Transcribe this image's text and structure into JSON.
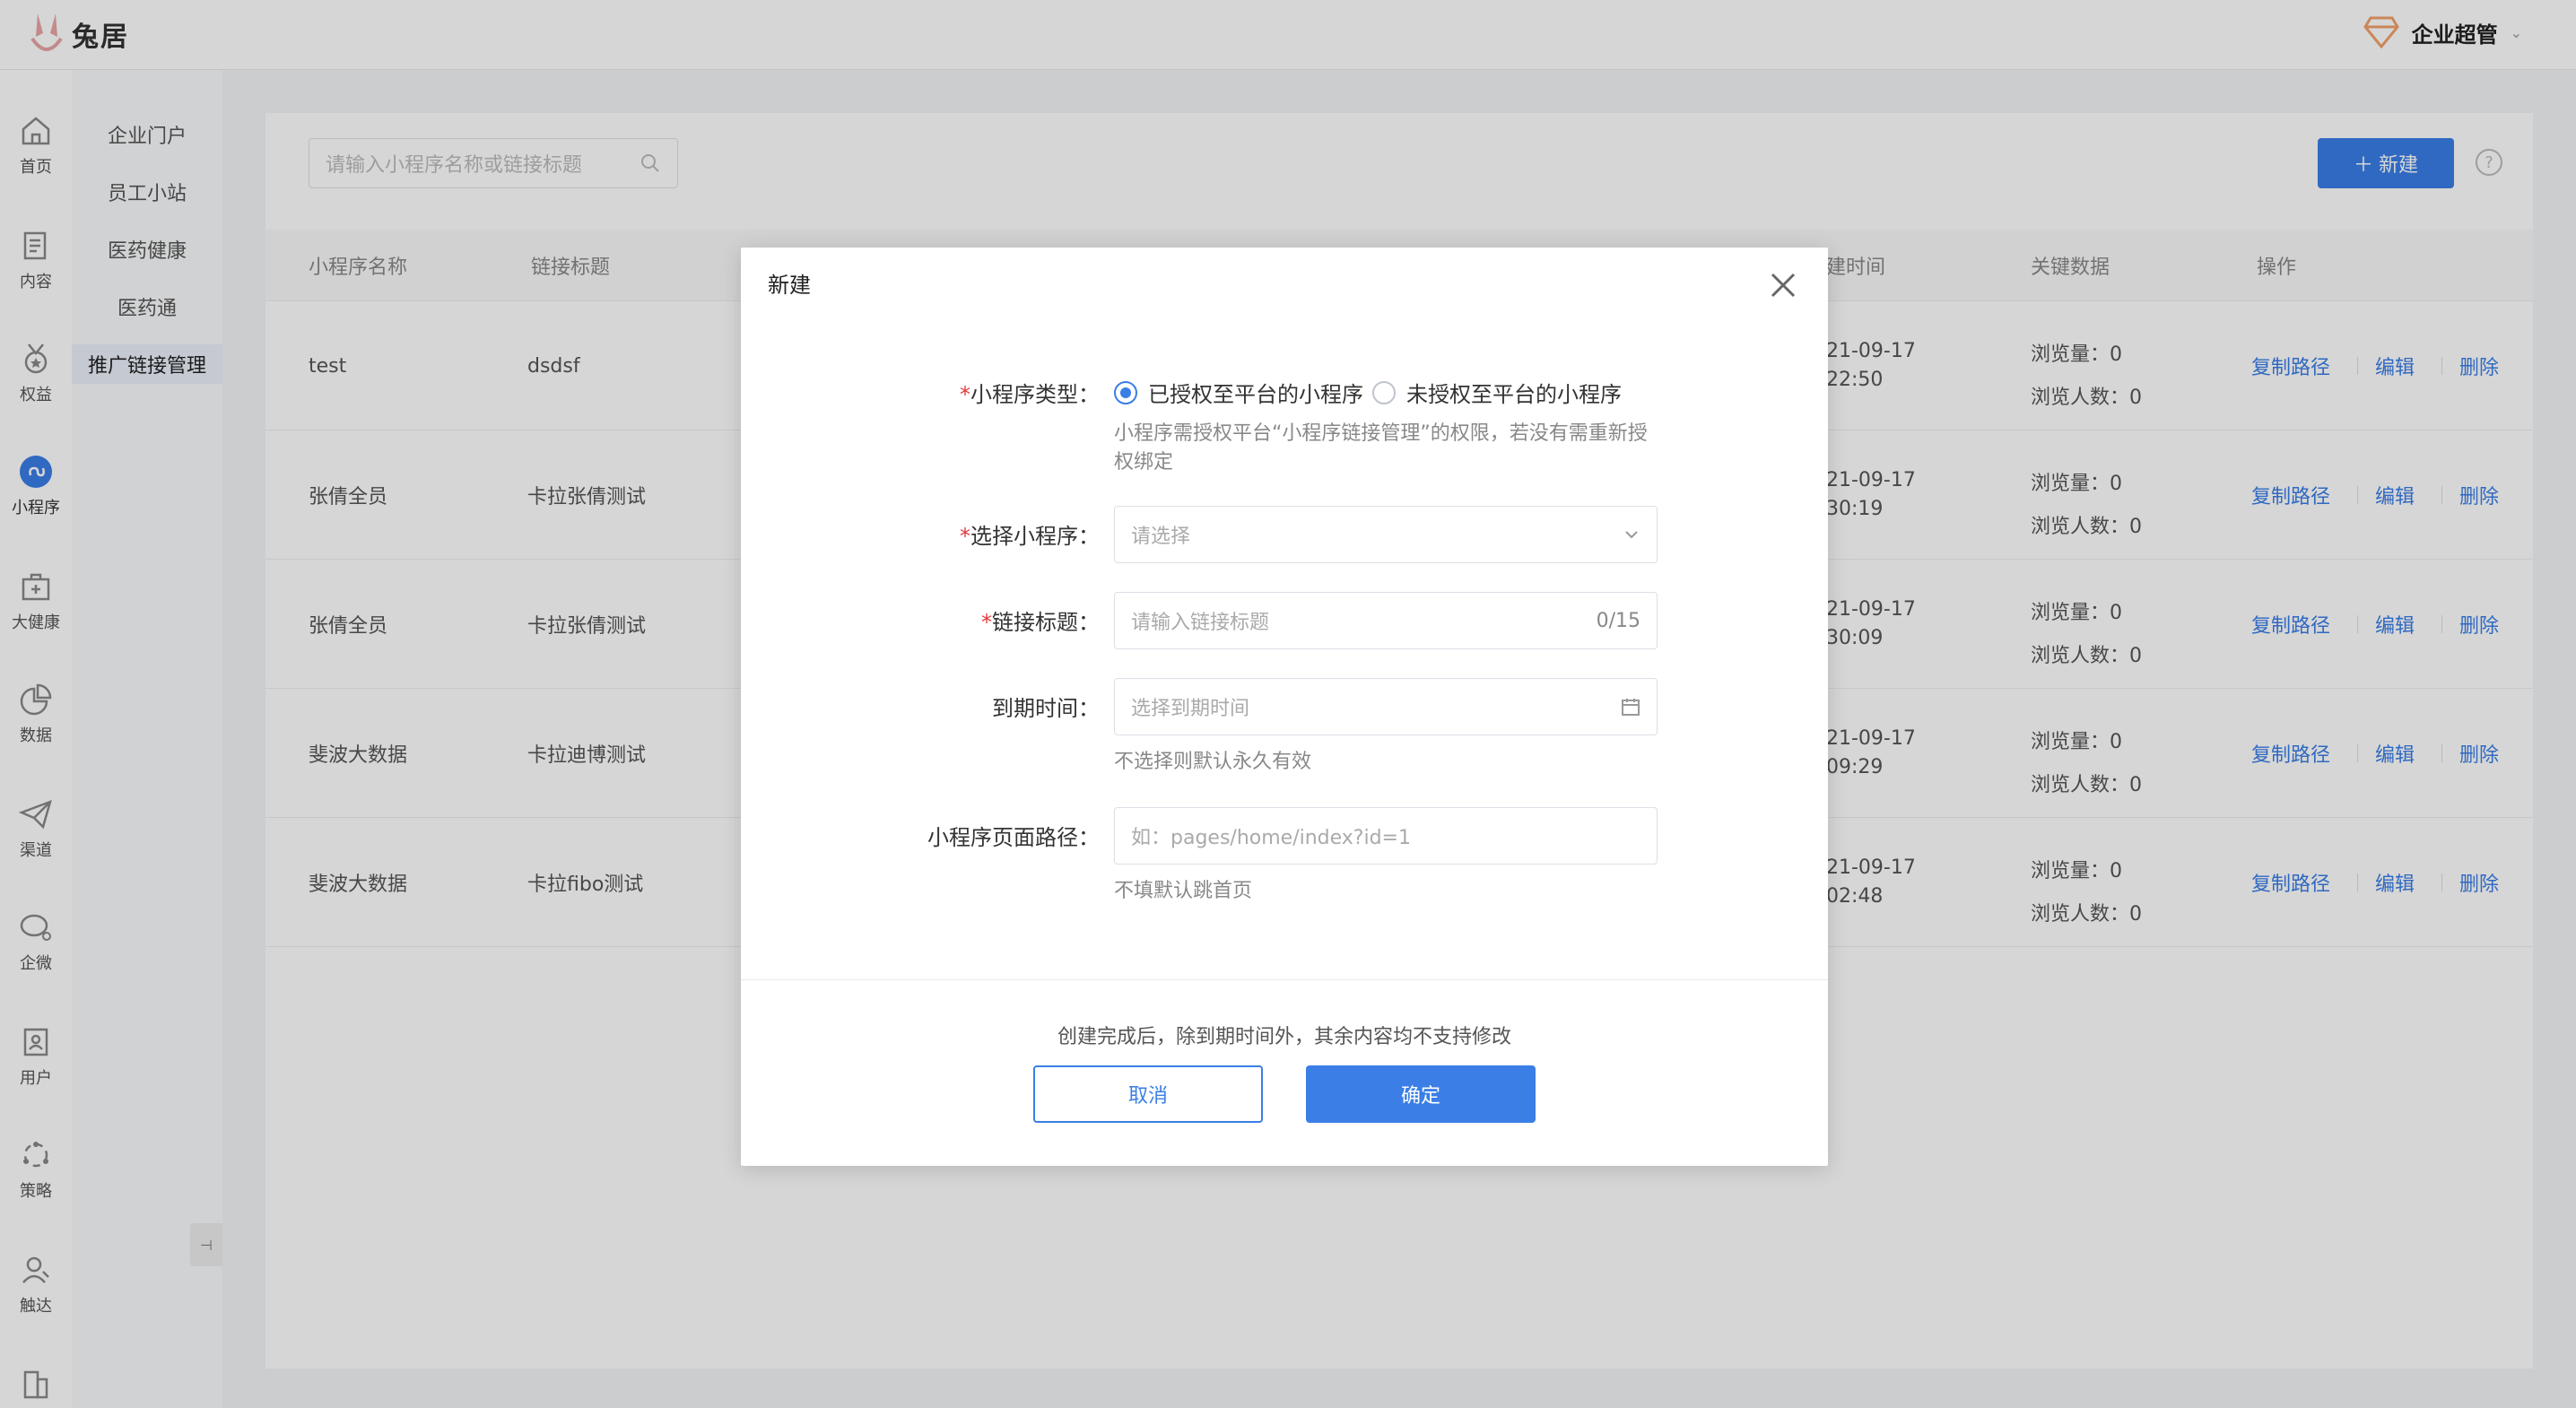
{
  "app": {
    "logo_text": "兔居",
    "user_name": "企业超管"
  },
  "rail": [
    {
      "label": "首页",
      "icon": "home-icon"
    },
    {
      "label": "内容",
      "icon": "document-icon"
    },
    {
      "label": "权益",
      "icon": "medal-icon"
    },
    {
      "label": "小程序",
      "icon": "miniprogram-icon"
    },
    {
      "label": "大健康",
      "icon": "health-kit-icon"
    },
    {
      "label": "数据",
      "icon": "pie-chart-icon"
    },
    {
      "label": "渠道",
      "icon": "paper-plane-icon"
    },
    {
      "label": "企微",
      "icon": "chat-icon"
    },
    {
      "label": "用户",
      "icon": "user-card-icon"
    },
    {
      "label": "策略",
      "icon": "strategy-icon"
    },
    {
      "label": "触达",
      "icon": "user-reach-icon"
    }
  ],
  "submenu": [
    "企业门户",
    "员工小站",
    "医药健康",
    "医药通",
    "推广链接管理"
  ],
  "toolbar": {
    "search_placeholder": "请输入小程序名称或链接标题",
    "new_label": "新建"
  },
  "table": {
    "headers": [
      "小程序名称",
      "链接标题",
      "建时间",
      "关键数据",
      "操作"
    ],
    "rows": [
      {
        "name": "test",
        "title": "dsdsf",
        "time1": "21-09-17",
        "time2": "22:50",
        "views": "浏览量：0",
        "visitors": "浏览人数：0"
      },
      {
        "name": "张倩全员",
        "title": "卡拉张倩测试",
        "time1": "21-09-17",
        "time2": "30:19",
        "views": "浏览量：0",
        "visitors": "浏览人数：0"
      },
      {
        "name": "张倩全员",
        "title": "卡拉张倩测试",
        "time1": "21-09-17",
        "time2": "30:09",
        "views": "浏览量：0",
        "visitors": "浏览人数：0"
      },
      {
        "name": "斐波大数据",
        "title": "卡拉迪博测试",
        "time1": "21-09-17",
        "time2": "09:29",
        "views": "浏览量：0",
        "visitors": "浏览人数：0"
      },
      {
        "name": "斐波大数据",
        "title": "卡拉fibo测试",
        "time1": "21-09-17",
        "time2": "02:48",
        "views": "浏览量：0",
        "visitors": "浏览人数：0"
      }
    ],
    "ops": {
      "copy": "复制路径",
      "edit": "编辑",
      "delete": "删除"
    }
  },
  "modal": {
    "title": "新建",
    "type_label": "小程序类型：",
    "type_options": [
      "已授权至平台的小程序",
      "未授权至平台的小程序"
    ],
    "type_hint_1": "小程序需授权平台“小程序链接管理”的权限，若没有需重新授",
    "type_hint_2": "权绑定",
    "select_label": "选择小程序：",
    "select_placeholder": "请选择",
    "title_label": "链接标题：",
    "title_placeholder": "请输入链接标题",
    "title_count": "0/15",
    "expire_label": "到期时间：",
    "expire_placeholder": "选择到期时间",
    "expire_hint": "不选择则默认永久有效",
    "path_label": "小程序页面路径：",
    "path_placeholder": "如：pages/home/index?id=1",
    "path_hint": "不填默认跳首页",
    "footer_note": "创建完成后，除到期时间外，其余内容均不支持修改",
    "cancel": "取消",
    "ok": "确定"
  }
}
